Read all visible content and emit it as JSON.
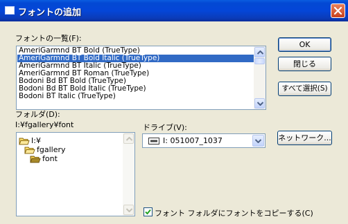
{
  "window": {
    "title": "フォントの追加"
  },
  "font_list": {
    "label": "フォントの一覧(F):",
    "items": [
      "AmeriGarmnd BT Bold (TrueType)",
      "AmeriGarmnd BT Bold Italic (TrueType)",
      "AmeriGarmnd BT Italic (TrueType)",
      "AmeriGarmnd BT Roman (TrueType)",
      "Bodoni Bd BT Bold (TrueType)",
      "Bodoni Bd BT Bold Italic (TrueType)",
      "Bodoni BT Italic (TrueType)"
    ],
    "selected_index": 1
  },
  "buttons": {
    "ok": "OK",
    "close": "閉じる",
    "select_all": "すべて選択(S)",
    "network": "ネットワーク..."
  },
  "folder": {
    "label": "フォルダ(D):",
    "path": "I:¥fgallery¥font",
    "items": [
      "I:¥",
      "fgallery",
      "font"
    ]
  },
  "drive": {
    "label": "ドライブ(V):",
    "value": "I: 051007_1037"
  },
  "copy_option": {
    "label": "フォント フォルダにフォントをコピーする(C)",
    "checked": true
  },
  "icons": {
    "title": "window-icon",
    "close": "close-x-icon",
    "folder_open": "open-folder-icon",
    "drive": "drive-icon",
    "scroll_up": "arrow-up-icon",
    "scroll_down": "arrow-down-icon",
    "check": "check-icon"
  }
}
